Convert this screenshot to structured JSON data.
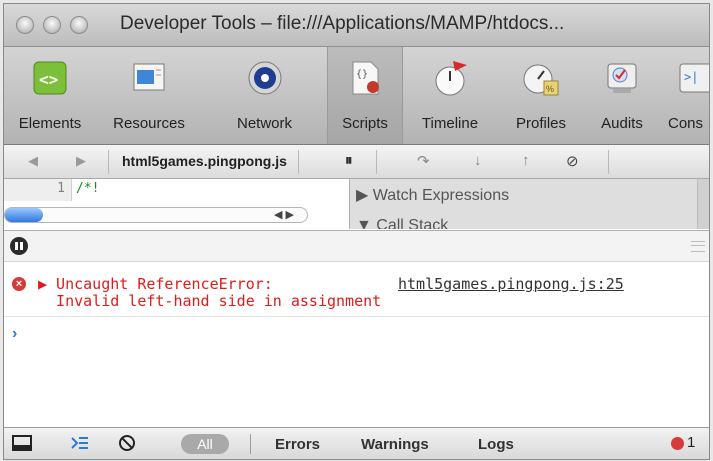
{
  "window": {
    "title": "Developer Tools – file:///Applications/MAMP/htdocs..."
  },
  "toolbar": {
    "items": [
      {
        "label": "Elements",
        "icon": "elements-icon"
      },
      {
        "label": "Resources",
        "icon": "resources-icon"
      },
      {
        "label": "Network",
        "icon": "network-icon"
      },
      {
        "label": "Scripts",
        "icon": "scripts-icon",
        "selected": true
      },
      {
        "label": "Timeline",
        "icon": "timeline-icon"
      },
      {
        "label": "Profiles",
        "icon": "profiles-icon"
      },
      {
        "label": "Audits",
        "icon": "audits-icon"
      },
      {
        "label": "Cons",
        "icon": "console-icon"
      }
    ]
  },
  "scripts_bar": {
    "back": "◀",
    "forward": "▶",
    "file": "html5games.pingpong.js",
    "pause_glyph": "⏸",
    "step_over": "↷",
    "step_into": "↓",
    "step_out": "↑",
    "deactivate": "⊘"
  },
  "source": {
    "line_number": "1",
    "line_code": "/*!"
  },
  "sidebar": {
    "watch_expressions": "▶ Watch Expressions",
    "call_stack": "▼ Call Stack"
  },
  "console": {
    "error_icon": "×",
    "error_line1": "▶ Uncaught ReferenceError:",
    "error_line2": "  Invalid left-hand side in assignment",
    "error_location": "html5games.pingpong.js:25",
    "prompt": "›"
  },
  "status_bar": {
    "all": "All",
    "errors": "Errors",
    "warnings": "Warnings",
    "logs": "Logs",
    "error_count": "1"
  },
  "colors": {
    "error_red": "#e11b1b",
    "prompt_blue": "#2a7bd6",
    "code_green": "#1f8a1f"
  }
}
